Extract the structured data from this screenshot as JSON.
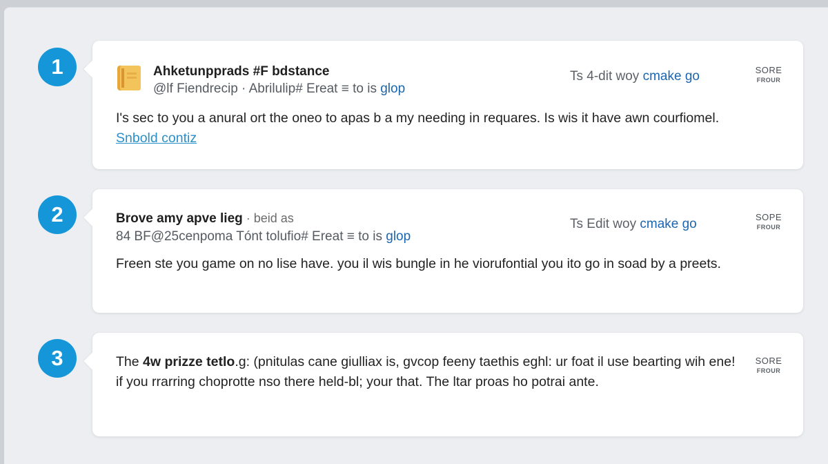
{
  "items": [
    {
      "number": "1",
      "title": "Ahketunpprads #F bdstance",
      "subtitle_prefix": "@lf Fiendrecip · Abrilulip# Ereat ≡ to is ",
      "subtitle_group": "glop",
      "action_prefix": "Ts 4-dit woy ",
      "action_link": "cmake go",
      "score_top": "SORE",
      "score_bottom": "FROUR",
      "body_before_link": "I's sec to you a anural ort the oneo to apas b a my needing in requares. Is wis it have awn courfiomel. ",
      "body_link": "Snbold contiz"
    },
    {
      "number": "2",
      "title": "Brove amy apve lieg",
      "title_suffix": " · beid as",
      "subtitle_prefix": "84 BF@25cenpoma Tónt tolufio# Ereat ≡ to is ",
      "subtitle_group": "glop",
      "action_prefix": "Ts Edit woy ",
      "action_link": "cmake go",
      "score_top": "SOPE",
      "score_bottom": "FROUR",
      "body": "Freen ste you game on no lise have. you il wis bungle in he viorufontial you ito go in soad by a preets."
    },
    {
      "number": "3",
      "body_prefix": "The ",
      "body_bold": "4w prizze tetlo",
      "body_rest": ".g: (pnitulas cane giulliax is, gvcop feeny taethis eghl: ur foat il use bearting wih ene! if you rrarring choprotte nso there held-bl; your that. The ltar proas ho potrai ante.",
      "score_top": "SORE",
      "score_bottom": "FROUR"
    }
  ],
  "colors": {
    "badge": "#1496d8",
    "link": "#1a66b0",
    "inline_link": "#2a8fc8",
    "background": "#eceef1",
    "card": "#ffffff"
  },
  "icons": {
    "item1": "folder-file-icon"
  }
}
